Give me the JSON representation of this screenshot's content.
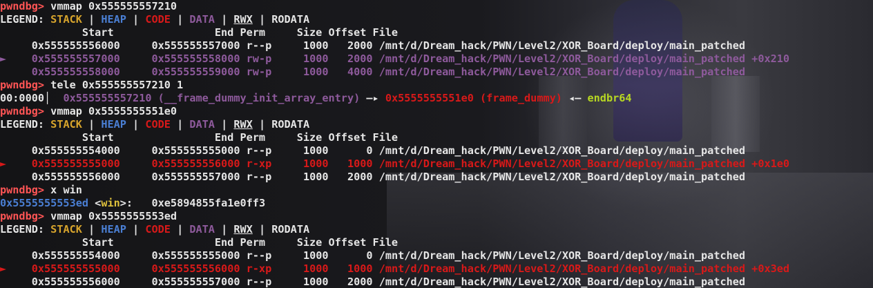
{
  "colors": {
    "prompt": "#ff5555",
    "stack": "#d7a42c",
    "heap": "#4a7fd4",
    "code": "#d81919",
    "data": "#8e5a9c",
    "text": "#e6e6e6",
    "instruction": "#b8d822",
    "symbol": "#e0c23c"
  },
  "prompt_label": "pwndbg>",
  "legend": {
    "label": "LEGEND:",
    "stack": "STACK",
    "heap": "HEAP",
    "code": "CODE",
    "data": "DATA",
    "rwx": "RWX",
    "rodata": "RODATA",
    "sep": " | "
  },
  "header": "             Start                End Perm     Size Offset File",
  "blocks": [
    {
      "command": "vmmap 0x555555557210",
      "rows": [
        {
          "marker": " ",
          "start": "0x555555556000",
          "end": "0x555555557000",
          "perm": "r--p",
          "size": "1000",
          "offset": "2000",
          "file": "/mnt/d/Dream_hack/PWN/Level2/XOR_Board/deploy/main_patched",
          "suffix": "",
          "type": "plain"
        },
        {
          "marker": "►",
          "start": "0x555555557000",
          "end": "0x555555558000",
          "perm": "rw-p",
          "size": "1000",
          "offset": "2000",
          "file": "/mnt/d/Dream_hack/PWN/Level2/XOR_Board/deploy/main_patched",
          "suffix": " +0x210",
          "type": "data"
        },
        {
          "marker": " ",
          "start": "0x555555558000",
          "end": "0x555555559000",
          "perm": "rw-p",
          "size": "1000",
          "offset": "4000",
          "file": "/mnt/d/Dream_hack/PWN/Level2/XOR_Board/deploy/main_patched",
          "suffix": "",
          "type": "data"
        }
      ]
    },
    {
      "command": "vmmap 0x5555555551e0",
      "rows": [
        {
          "marker": " ",
          "start": "0x555555554000",
          "end": "0x555555555000",
          "perm": "r--p",
          "size": "1000",
          "offset": "0",
          "file": "/mnt/d/Dream_hack/PWN/Level2/XOR_Board/deploy/main_patched",
          "suffix": "",
          "type": "plain"
        },
        {
          "marker": "►",
          "start": "0x555555555000",
          "end": "0x555555556000",
          "perm": "r-xp",
          "size": "1000",
          "offset": "1000",
          "file": "/mnt/d/Dream_hack/PWN/Level2/XOR_Board/deploy/main_patched",
          "suffix": " +0x1e0",
          "type": "code"
        },
        {
          "marker": " ",
          "start": "0x555555556000",
          "end": "0x555555557000",
          "perm": "r--p",
          "size": "1000",
          "offset": "2000",
          "file": "/mnt/d/Dream_hack/PWN/Level2/XOR_Board/deploy/main_patched",
          "suffix": "",
          "type": "plain"
        }
      ]
    },
    {
      "command": "vmmap 0x5555555553ed",
      "rows": [
        {
          "marker": " ",
          "start": "0x555555554000",
          "end": "0x555555555000",
          "perm": "r--p",
          "size": "1000",
          "offset": "0",
          "file": "/mnt/d/Dream_hack/PWN/Level2/XOR_Board/deploy/main_patched",
          "suffix": "",
          "type": "plain"
        },
        {
          "marker": "►",
          "start": "0x555555555000",
          "end": "0x555555556000",
          "perm": "r-xp",
          "size": "1000",
          "offset": "1000",
          "file": "/mnt/d/Dream_hack/PWN/Level2/XOR_Board/deploy/main_patched",
          "suffix": " +0x3ed",
          "type": "code"
        },
        {
          "marker": " ",
          "start": "0x555555556000",
          "end": "0x555555557000",
          "perm": "r--p",
          "size": "1000",
          "offset": "2000",
          "file": "/mnt/d/Dream_hack/PWN/Level2/XOR_Board/deploy/main_patched",
          "suffix": "",
          "type": "plain"
        }
      ]
    }
  ],
  "tele": {
    "command": "tele 0x555555557210 1",
    "index": "00:0000",
    "bar": "│",
    "addr": "0x555555557210",
    "addr_sym": "(__frame_dummy_init_array_entry)",
    "arrow1": "—▸",
    "target": "0x5555555551e0",
    "target_sym": "(frame_dummy)",
    "arrow2": "◂—",
    "instruction": "endbr64"
  },
  "xwin": {
    "command": "x win",
    "addr": "0x5555555553ed",
    "sym_open": "<",
    "sym": "win",
    "sym_close": ">:",
    "value": "0xe5894855fa1e0ff3"
  }
}
